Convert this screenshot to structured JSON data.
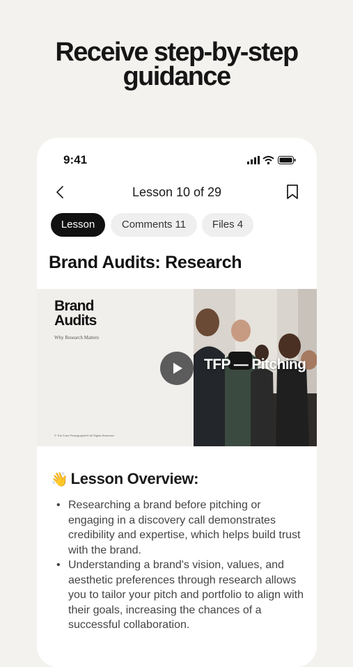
{
  "headline": {
    "line1": "Receive step-by-step",
    "line2": "guidance"
  },
  "status_bar": {
    "time": "9:41"
  },
  "nav": {
    "title": "Lesson 10 of 29"
  },
  "tabs": [
    {
      "label": "Lesson",
      "active": true
    },
    {
      "label": "Comments 11",
      "active": false
    },
    {
      "label": "Files 4",
      "active": false
    }
  ],
  "lesson": {
    "title": "Brand Audits: Research"
  },
  "video": {
    "slide_title_line1": "Brand",
    "slide_title_line2": "Audits",
    "slide_subtitle": "Why Research Matters",
    "slide_footer": "© The Futur Photographer® All Rights Reserved",
    "overlay_text": "TFP — Pitching"
  },
  "overview": {
    "emoji": "👋",
    "heading": "Lesson Overview:",
    "bullets": [
      "Researching a brand before pitching or engaging in a discovery call demonstrates credibility and expertise, which helps build trust with the brand.",
      "Understanding a brand's vision, values, and aesthetic preferences through research allows you to tailor your pitch and portfolio to align with their goals, increasing the chances of a successful collaboration."
    ]
  },
  "colors": {
    "background": "#f3f2ee",
    "card": "#ffffff",
    "accent": "#111111",
    "chip": "#efefef"
  }
}
